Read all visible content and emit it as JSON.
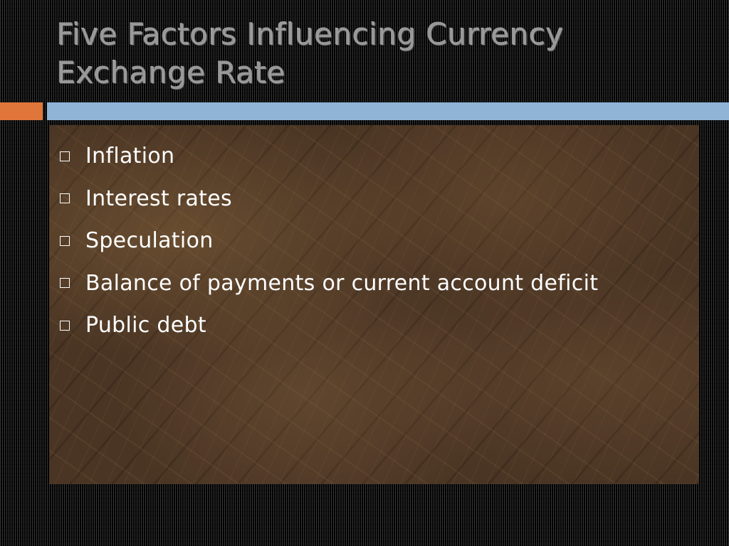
{
  "slide": {
    "title": "Five Factors Influencing Currency Exchange Rate",
    "bullets": [
      {
        "label": "Inflation"
      },
      {
        "label": "Interest rates"
      },
      {
        "label": "Speculation"
      },
      {
        "label": "Balance of payments or current account deficit"
      },
      {
        "label": "Public debt"
      }
    ]
  },
  "colors": {
    "accent_orange": "#e0763a",
    "header_blue": "#8fb4d6",
    "title_gray": "#9a9a9a",
    "panel_brown": "#4a3524",
    "bullet_text": "#ffffff"
  },
  "icons": {
    "bullet": "hollow-square-icon"
  }
}
